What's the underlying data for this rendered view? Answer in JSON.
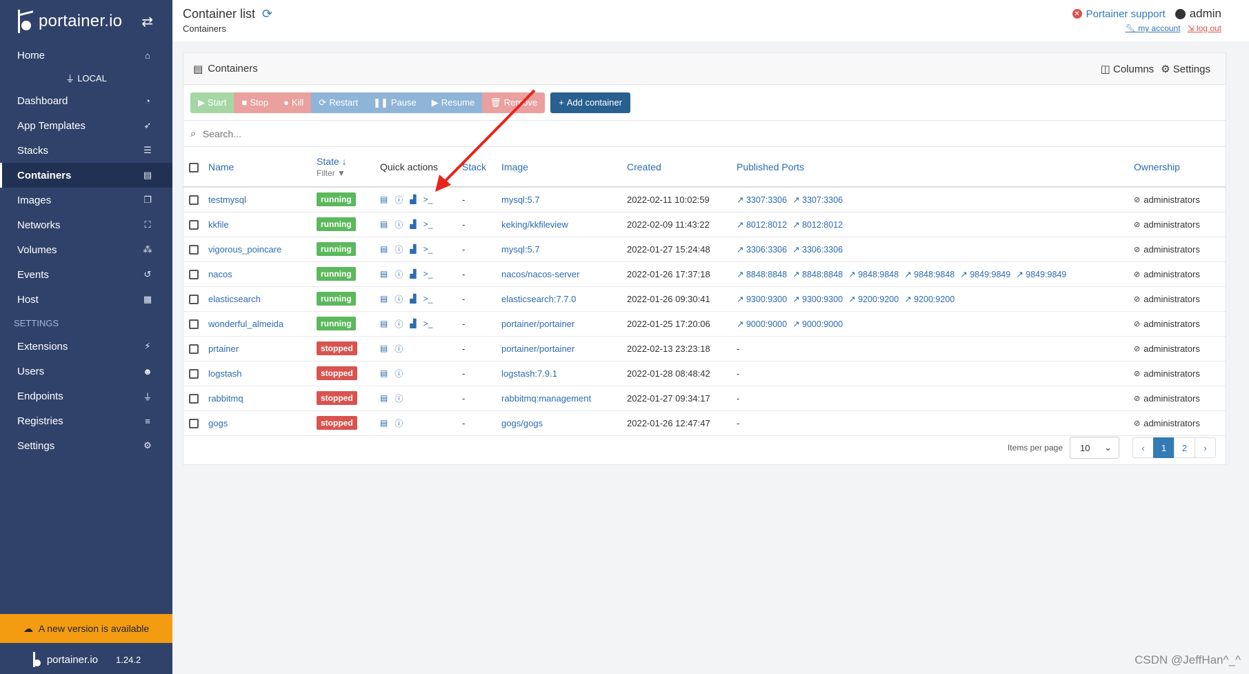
{
  "sidebar": {
    "brand": "portainer.io",
    "items": [
      {
        "label": "Home",
        "icon": "home-icon",
        "glyph": "⌂"
      },
      {
        "label": "Dashboard",
        "icon": "dashboard-icon",
        "glyph": "◔"
      },
      {
        "label": "App Templates",
        "icon": "rocket-icon",
        "glyph": "➶"
      },
      {
        "label": "Stacks",
        "icon": "list-icon",
        "glyph": "☰"
      },
      {
        "label": "Containers",
        "icon": "server-icon",
        "glyph": "▤"
      },
      {
        "label": "Images",
        "icon": "clone-icon",
        "glyph": "❐"
      },
      {
        "label": "Networks",
        "icon": "sitemap-icon",
        "glyph": "⛶"
      },
      {
        "label": "Volumes",
        "icon": "cubes-icon",
        "glyph": "⁂"
      },
      {
        "label": "Events",
        "icon": "history-icon",
        "glyph": "↺"
      },
      {
        "label": "Host",
        "icon": "th-icon",
        "glyph": "▦"
      }
    ],
    "endpoint": "LOCAL",
    "settings_section": "SETTINGS",
    "settings_items": [
      {
        "label": "Extensions",
        "icon": "bolt-icon",
        "glyph": "⚡"
      },
      {
        "label": "Users",
        "icon": "users-icon",
        "glyph": "☻"
      },
      {
        "label": "Endpoints",
        "icon": "plug-icon",
        "glyph": "⏚"
      },
      {
        "label": "Registries",
        "icon": "database-icon",
        "glyph": "≡"
      },
      {
        "label": "Settings",
        "icon": "cogs-icon",
        "glyph": "⚙"
      }
    ],
    "update_notice": "A new version is available",
    "footer_brand": "portainer.io",
    "version": "1.24.2"
  },
  "header": {
    "title": "Container list",
    "breadcrumb": "Containers",
    "support": "Portainer support",
    "user": "admin",
    "my_account": "my account",
    "log_out": "log out"
  },
  "panel": {
    "title": "Containers",
    "columns": "Columns",
    "settings": "Settings",
    "buttons": {
      "start": "Start",
      "stop": "Stop",
      "kill": "Kill",
      "restart": "Restart",
      "pause": "Pause",
      "resume": "Resume",
      "remove": "Remove",
      "add": "Add container"
    },
    "search_placeholder": "Search..."
  },
  "table": {
    "headers": {
      "name": "Name",
      "state": "State ↓",
      "filter": "Filter",
      "quick_actions": "Quick actions",
      "stack": "Stack",
      "image": "Image",
      "created": "Created",
      "ports": "Published Ports",
      "ownership": "Ownership"
    },
    "rows": [
      {
        "name": "testmysql",
        "state": "running",
        "stack": "-",
        "image": "mysql:5.7",
        "created": "2022-02-11 10:02:59",
        "ports": [
          "3307:3306",
          "3307:3306"
        ],
        "owner": "administrators"
      },
      {
        "name": "kkfile",
        "state": "running",
        "stack": "-",
        "image": "keking/kkfileview",
        "created": "2022-02-09 11:43:22",
        "ports": [
          "8012:8012",
          "8012:8012"
        ],
        "owner": "administrators"
      },
      {
        "name": "vigorous_poincare",
        "state": "running",
        "stack": "-",
        "image": "mysql:5.7",
        "created": "2022-01-27 15:24:48",
        "ports": [
          "3306:3306",
          "3306:3306"
        ],
        "owner": "administrators"
      },
      {
        "name": "nacos",
        "state": "running",
        "stack": "-",
        "image": "nacos/nacos-server",
        "created": "2022-01-26 17:37:18",
        "ports": [
          "8848:8848",
          "8848:8848",
          "9848:9848",
          "9848:9848",
          "9849:9849",
          "9849:9849"
        ],
        "owner": "administrators"
      },
      {
        "name": "elasticsearch",
        "state": "running",
        "stack": "-",
        "image": "elasticsearch:7.7.0",
        "created": "2022-01-26 09:30:41",
        "ports": [
          "9300:9300",
          "9300:9300",
          "9200:9200",
          "9200:9200"
        ],
        "owner": "administrators"
      },
      {
        "name": "wonderful_almeida",
        "state": "running",
        "stack": "-",
        "image": "portainer/portainer",
        "created": "2022-01-25 17:20:06",
        "ports": [
          "9000:9000",
          "9000:9000"
        ],
        "owner": "administrators"
      },
      {
        "name": "prtainer",
        "state": "stopped",
        "stack": "-",
        "image": "portainer/portainer",
        "created": "2022-02-13 23:23:18",
        "ports": [],
        "owner": "administrators"
      },
      {
        "name": "logstash",
        "state": "stopped",
        "stack": "-",
        "image": "logstash:7.9.1",
        "created": "2022-01-28 08:48:42",
        "ports": [],
        "owner": "administrators"
      },
      {
        "name": "rabbitmq",
        "state": "stopped",
        "stack": "-",
        "image": "rabbitmq:management",
        "created": "2022-01-27 09:34:17",
        "ports": [],
        "owner": "administrators"
      },
      {
        "name": "gogs",
        "state": "stopped",
        "stack": "-",
        "image": "gogs/gogs",
        "created": "2022-01-26 12:47:47",
        "ports": [],
        "owner": "administrators"
      }
    ],
    "no_ports": "-"
  },
  "pagination": {
    "items_per_page_label": "Items per page",
    "items_per_page": "10",
    "prev": "‹",
    "next": "›",
    "pages": [
      "1",
      "2"
    ]
  },
  "watermark": "CSDN @JeffHan^_^",
  "colors": {
    "sidebar": "#30426a",
    "running": "#5cb85c",
    "stopped": "#d9534f",
    "primary": "#337ab7",
    "update": "#f39c12"
  }
}
